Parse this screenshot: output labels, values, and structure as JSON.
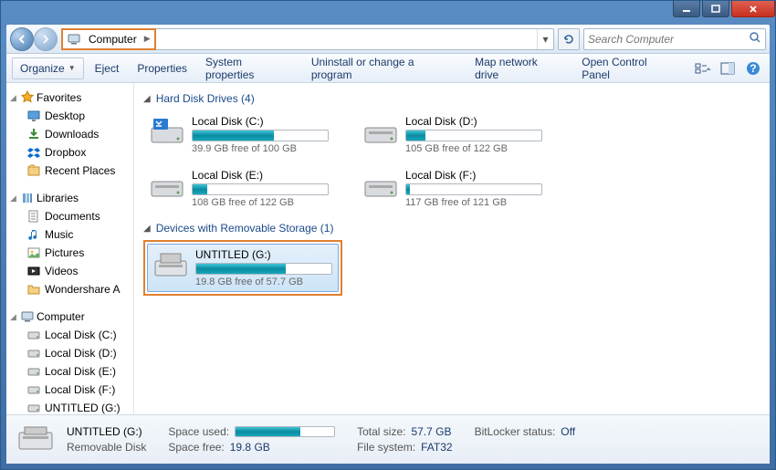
{
  "window": {
    "title": ""
  },
  "nav": {
    "breadcrumb": [
      "Computer"
    ],
    "search_placeholder": "Search Computer"
  },
  "toolbar": {
    "organize": "Organize",
    "items": [
      "Eject",
      "Properties",
      "System properties",
      "Uninstall or change a program",
      "Map network drive",
      "Open Control Panel"
    ]
  },
  "sidebar": {
    "groups": [
      {
        "name": "Favorites",
        "icon": "star",
        "items": [
          {
            "label": "Desktop",
            "icon": "desktop"
          },
          {
            "label": "Downloads",
            "icon": "download"
          },
          {
            "label": "Dropbox",
            "icon": "dropbox"
          },
          {
            "label": "Recent Places",
            "icon": "recent"
          }
        ]
      },
      {
        "name": "Libraries",
        "icon": "library",
        "items": [
          {
            "label": "Documents",
            "icon": "doc"
          },
          {
            "label": "Music",
            "icon": "music"
          },
          {
            "label": "Pictures",
            "icon": "picture"
          },
          {
            "label": "Videos",
            "icon": "video"
          },
          {
            "label": "Wondershare A",
            "icon": "folder"
          }
        ]
      },
      {
        "name": "Computer",
        "icon": "computer",
        "items": [
          {
            "label": "Local Disk (C:)",
            "icon": "hdd"
          },
          {
            "label": "Local Disk (D:)",
            "icon": "hdd"
          },
          {
            "label": "Local Disk (E:)",
            "icon": "hdd"
          },
          {
            "label": "Local Disk (F:)",
            "icon": "hdd"
          },
          {
            "label": "UNTITLED (G:)",
            "icon": "hdd"
          }
        ]
      }
    ]
  },
  "sections": [
    {
      "title": "Hard Disk Drives (4)",
      "drives": [
        {
          "name": "Local Disk (C:)",
          "free": "39.9 GB free of 100 GB",
          "pct": 60,
          "icon": "hdd-win"
        },
        {
          "name": "Local Disk (D:)",
          "free": "105 GB free of 122 GB",
          "pct": 14,
          "icon": "hdd"
        },
        {
          "name": "Local Disk (E:)",
          "free": "108 GB free of 122 GB",
          "pct": 11,
          "icon": "hdd"
        },
        {
          "name": "Local Disk (F:)",
          "free": "117 GB free of 121 GB",
          "pct": 3,
          "icon": "hdd"
        }
      ]
    },
    {
      "title": "Devices with Removable Storage (1)",
      "drives": [
        {
          "name": "UNTITLED (G:)",
          "free": "19.8 GB free of 57.7 GB",
          "pct": 66,
          "icon": "removable",
          "selected": true,
          "highlighted": true
        }
      ]
    }
  ],
  "details": {
    "name": "UNTITLED (G:)",
    "type": "Removable Disk",
    "space_used_label": "Space used:",
    "space_used_pct": 66,
    "space_free_label": "Space free:",
    "space_free": "19.8 GB",
    "total_label": "Total size:",
    "total": "57.7 GB",
    "fs_label": "File system:",
    "fs": "FAT32",
    "bitlocker_label": "BitLocker status:",
    "bitlocker": "Off"
  }
}
